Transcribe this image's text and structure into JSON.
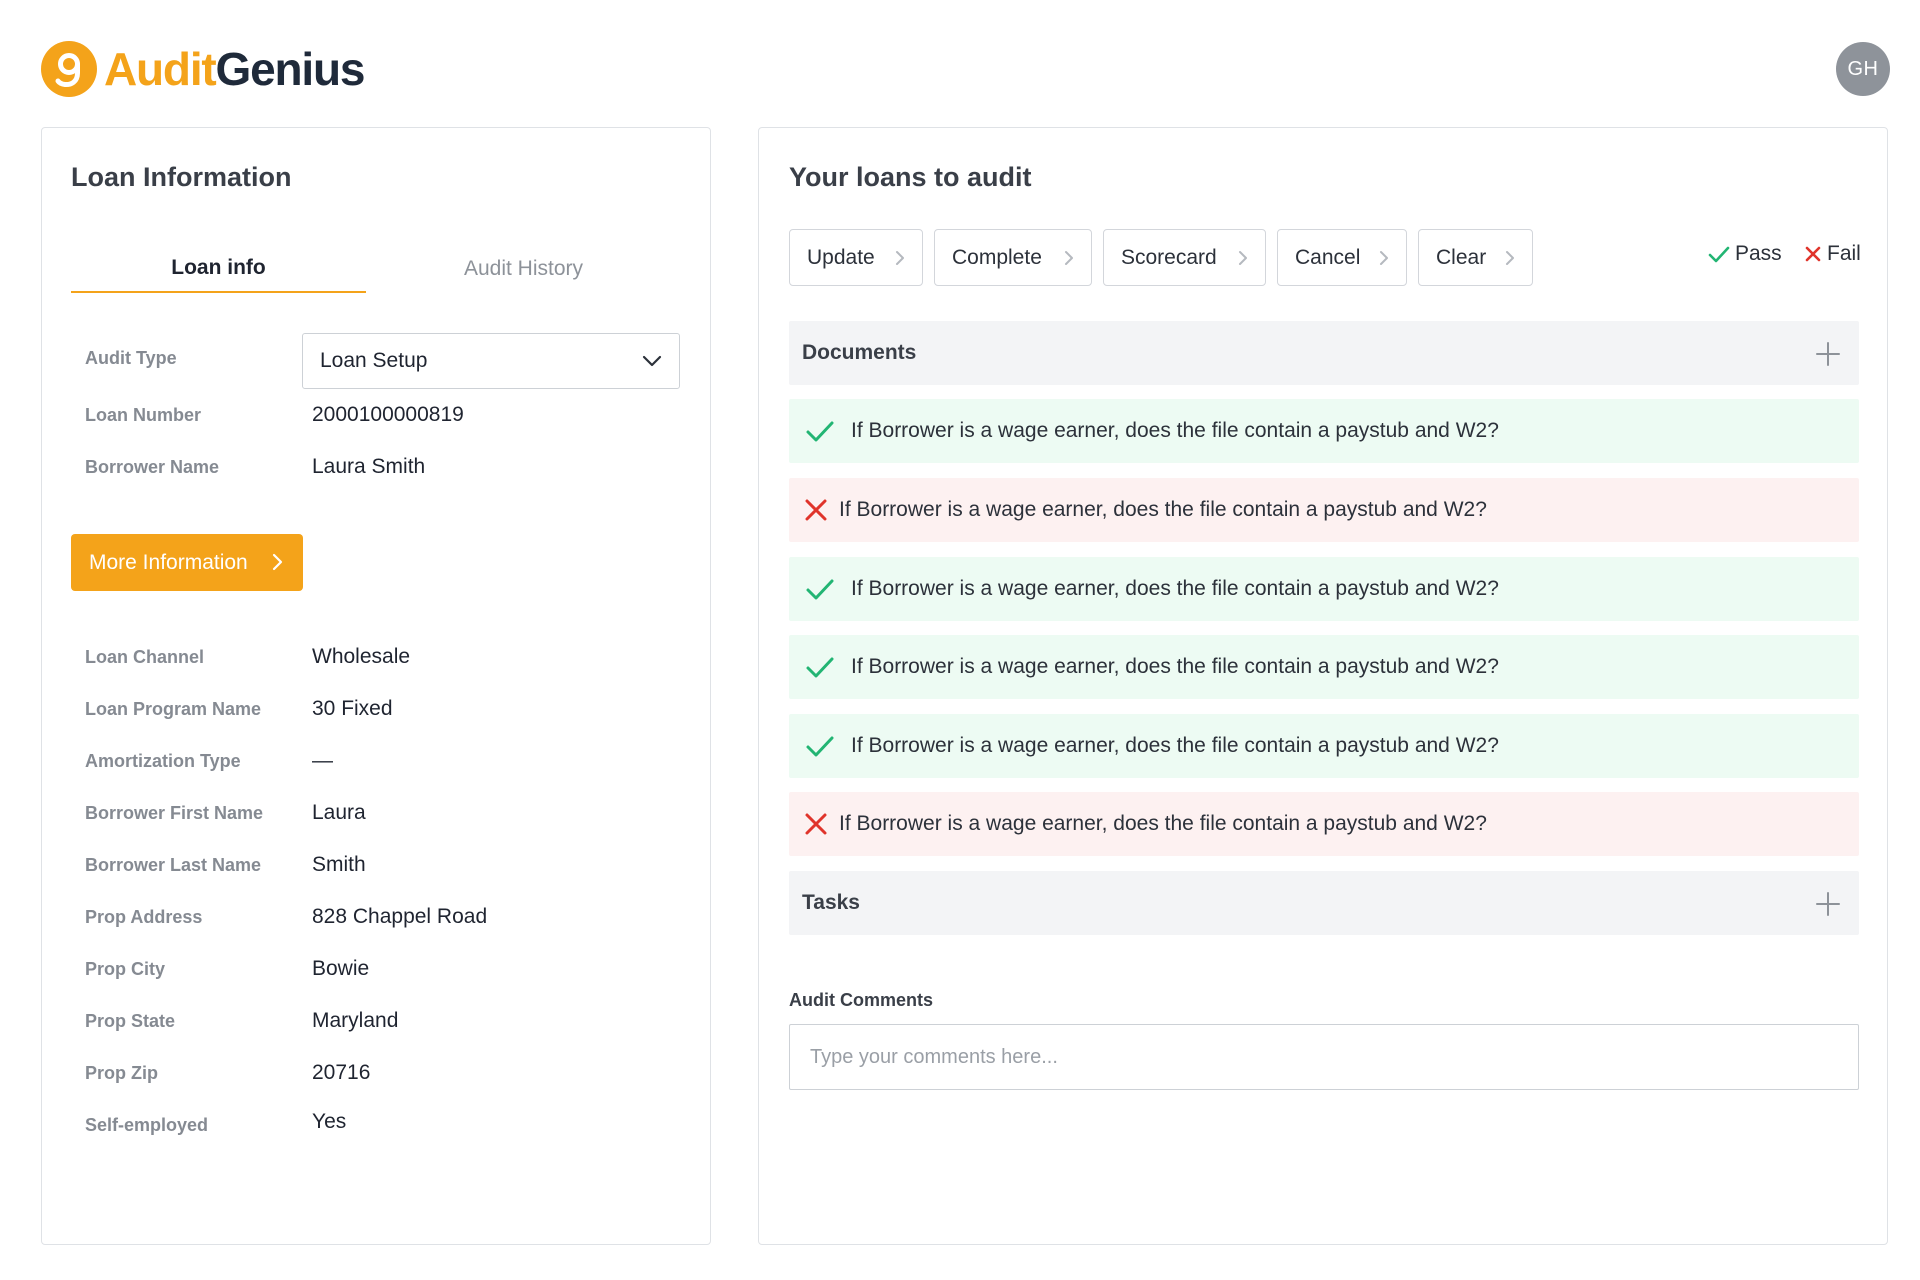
{
  "brand": {
    "name_part1": "Audit",
    "name_part2": "Genius",
    "accent": "#f4a31a",
    "dark": "#1f2a3a"
  },
  "user": {
    "initials": "GH"
  },
  "left_panel": {
    "title": "Loan Information",
    "tabs": [
      {
        "label": "Loan info",
        "active": true
      },
      {
        "label": "Audit History",
        "active": false
      }
    ],
    "audit_type": {
      "label": "Audit Type",
      "value": "Loan Setup"
    },
    "top_fields": [
      {
        "label": "Loan Number",
        "value": "2000100000819"
      },
      {
        "label": "Borrower Name",
        "value": "Laura Smith"
      }
    ],
    "more_button": "More Information",
    "fields": [
      {
        "label": "Loan Channel",
        "value": "Wholesale"
      },
      {
        "label": "Loan Program Name",
        "value": "30 Fixed"
      },
      {
        "label": "Amortization Type",
        "value": "—"
      },
      {
        "label": "Borrower First Name",
        "value": "Laura"
      },
      {
        "label": "Borrower Last Name",
        "value": "Smith"
      },
      {
        "label": "Prop Address",
        "value": "828 Chappel Road"
      },
      {
        "label": "Prop City",
        "value": "Bowie"
      },
      {
        "label": "Prop State",
        "value": "Maryland"
      },
      {
        "label": "Prop Zip",
        "value": "20716"
      },
      {
        "label": "Self-employed",
        "value": "Yes"
      }
    ]
  },
  "right_panel": {
    "title": "Your loans to audit",
    "toolbar": [
      "Update",
      "Complete",
      "Scorecard",
      "Cancel",
      "Clear"
    ],
    "legend": {
      "pass": "Pass",
      "fail": "Fail",
      "pass_color": "#22b573",
      "fail_color": "#e0342b"
    },
    "documents_label": "Documents",
    "questions": [
      {
        "status": "pass",
        "text": "If Borrower is a wage earner, does the file contain a paystub and W2?"
      },
      {
        "status": "fail",
        "text": "If Borrower is a wage earner, does the file contain a paystub and W2?"
      },
      {
        "status": "pass",
        "text": "If Borrower is a wage earner, does the file contain a paystub and W2?"
      },
      {
        "status": "pass",
        "text": "If Borrower is a wage earner, does the file contain a paystub and W2?"
      },
      {
        "status": "pass",
        "text": "If Borrower is a wage earner, does the file contain a paystub and W2?"
      },
      {
        "status": "fail",
        "text": "If Borrower is a wage earner, does the file contain a paystub and W2?"
      }
    ],
    "tasks_label": "Tasks",
    "comments": {
      "label": "Audit Comments",
      "value": "",
      "placeholder": "Type your comments here..."
    }
  }
}
